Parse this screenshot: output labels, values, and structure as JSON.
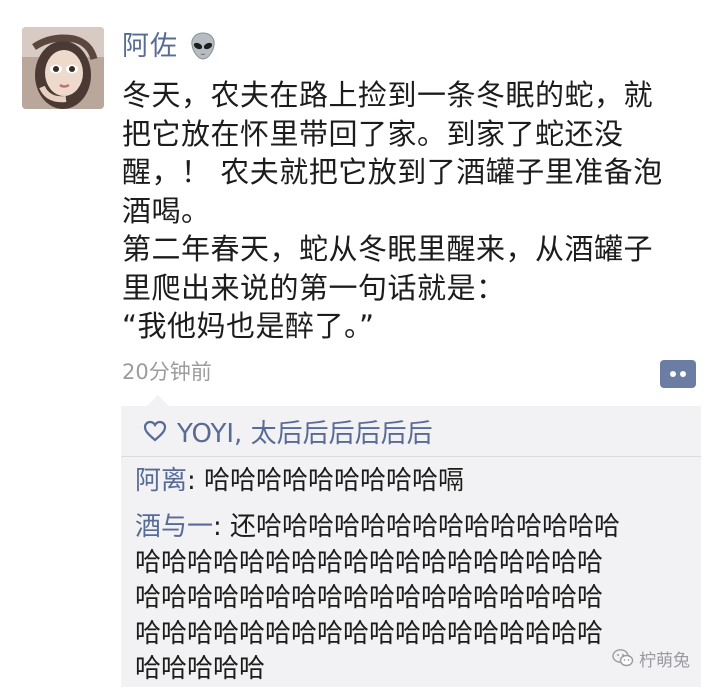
{
  "post": {
    "author": "阿佐",
    "author_badge_icon": "alien-emoji-icon",
    "body_lines": [
      "冬天，农夫在路上捡到一条冬眠的蛇，就",
      "把它放在怀里带回了家。到家了蛇还没",
      "醒，！ 农夫就把它放到了酒罐子里准备泡",
      "酒喝。",
      "第二年春天，蛇从冬眠里醒来，从酒罐子",
      "里爬出来说的第一句话就是：",
      "“我他妈也是醉了。”"
    ],
    "time": "20分钟前",
    "comment_button_icon": "comment-bubble-icon"
  },
  "likes": {
    "icon": "heart-icon",
    "names": "YOYI, 太后后后后后后"
  },
  "comments": [
    {
      "author": "阿离",
      "separator": ": ",
      "first_line": "哈哈哈哈哈哈哈哈哈嗝",
      "more_lines": []
    },
    {
      "author": "酒与一",
      "separator": ": ",
      "first_line": "还哈哈哈哈哈哈哈哈哈哈哈哈哈哈",
      "more_lines": [
        "哈哈哈哈哈哈哈哈哈哈哈哈哈哈哈哈哈哈",
        "哈哈哈哈哈哈哈哈哈哈哈哈哈哈哈哈哈哈",
        "哈哈哈哈哈哈哈哈哈哈哈哈哈哈哈哈哈哈",
        "哈哈哈哈哈"
      ]
    }
  ],
  "watermark": {
    "icon": "wechat-icon",
    "text": "柠萌兔"
  },
  "colors": {
    "name_blue": "#586b95",
    "comment_panel_bg": "#f2f2f4",
    "time_gray": "#9c9c9c",
    "comment_button_bg": "#6b7da3"
  }
}
